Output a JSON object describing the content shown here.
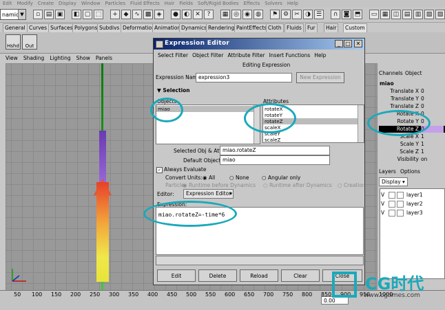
{
  "main_menu": [
    "Edit",
    "Modify",
    "Create",
    "Display",
    "Window",
    "Particles",
    "Fluid Effects",
    "Hair",
    "Fields",
    "Soft/Rigid Bodies",
    "Effects",
    "Solvers",
    "Help"
  ],
  "mode_dropdown": "namics",
  "shelf_tabs": [
    "General",
    "Curves",
    "Surfaces",
    "Polygons",
    "Subdivs",
    "Deformation",
    "Animation",
    "Dynamics",
    "Rendering",
    "PaintEffects",
    "Cloth",
    "Fluids",
    "Fur",
    "Hair",
    "Custom"
  ],
  "shelf_buttons": [
    "Hshd",
    "Out"
  ],
  "viewport_menu": [
    "View",
    "Shading",
    "Lighting",
    "Show",
    "Panels"
  ],
  "timeline_ticks": [
    "50",
    "100",
    "150",
    "200",
    "250",
    "300",
    "350",
    "400",
    "450",
    "500",
    "550",
    "600",
    "650",
    "700",
    "750",
    "800",
    "850",
    "900",
    "950",
    "1000"
  ],
  "timeline_value": "0.00",
  "channel_box": {
    "header": [
      "Channels",
      "Object"
    ],
    "object_name": "miao",
    "channels": [
      {
        "name": "Translate X",
        "value": "0"
      },
      {
        "name": "Translate Y",
        "value": "0"
      },
      {
        "name": "Translate Z",
        "value": "0"
      },
      {
        "name": "Rotate X",
        "value": "0"
      },
      {
        "name": "Rotate Y",
        "value": "0"
      },
      {
        "name": "Rotate Z",
        "value": "0"
      },
      {
        "name": "Scale X",
        "value": "1"
      },
      {
        "name": "Scale Y",
        "value": "1"
      },
      {
        "name": "Scale Z",
        "value": "1"
      },
      {
        "name": "Visibility",
        "value": "on"
      }
    ]
  },
  "layers": {
    "header": [
      "Layers",
      "Options"
    ],
    "display_dropdown": "Display",
    "items": [
      {
        "visible": "V",
        "name": "layer1"
      },
      {
        "visible": "V",
        "name": "layer2"
      },
      {
        "visible": "V",
        "name": "layer3"
      }
    ]
  },
  "expression_editor": {
    "title": "Expression Editor",
    "menu": [
      "Select Filter",
      "Object Filter",
      "Attribute Filter",
      "Insert Functions",
      "Help"
    ],
    "subtitle": "Editing Expression",
    "expression_name_label": "Expression Name",
    "expression_name_value": "expression3",
    "new_expression_button": "New Expression",
    "selection_header": "Selection",
    "objects_label": "Objects",
    "objects": [
      "miao"
    ],
    "attributes_label": "Attributes",
    "attributes": [
      "rotateX",
      "rotateY",
      "rotateZ",
      "scaleX",
      "scaleY",
      "scaleZ"
    ],
    "selected_attr_label": "Selected Obj & Attr",
    "selected_attr_value": "miao.rotateZ",
    "default_object_label": "Default Object",
    "default_object_value": "miao",
    "always_evaluate_label": "Always Evaluate",
    "convert_units_label": "Convert Units:",
    "convert_units_options": [
      "All",
      "None",
      "Angular only"
    ],
    "particle_label": "Particle:",
    "particle_options": [
      "Runtime before Dynamics",
      "Runtime after Dynamics",
      "Creation"
    ],
    "editor_label": "Editor:",
    "editor_value": "Expression Editor",
    "expression_label": "Expression:",
    "expression_text": "miao.rotateZ=-time*6",
    "buttons": [
      "Edit",
      "Delete",
      "Reload",
      "Clear",
      "Close"
    ]
  },
  "watermark": {
    "text": "CG时代",
    "url": "www.cgtimes.com"
  }
}
